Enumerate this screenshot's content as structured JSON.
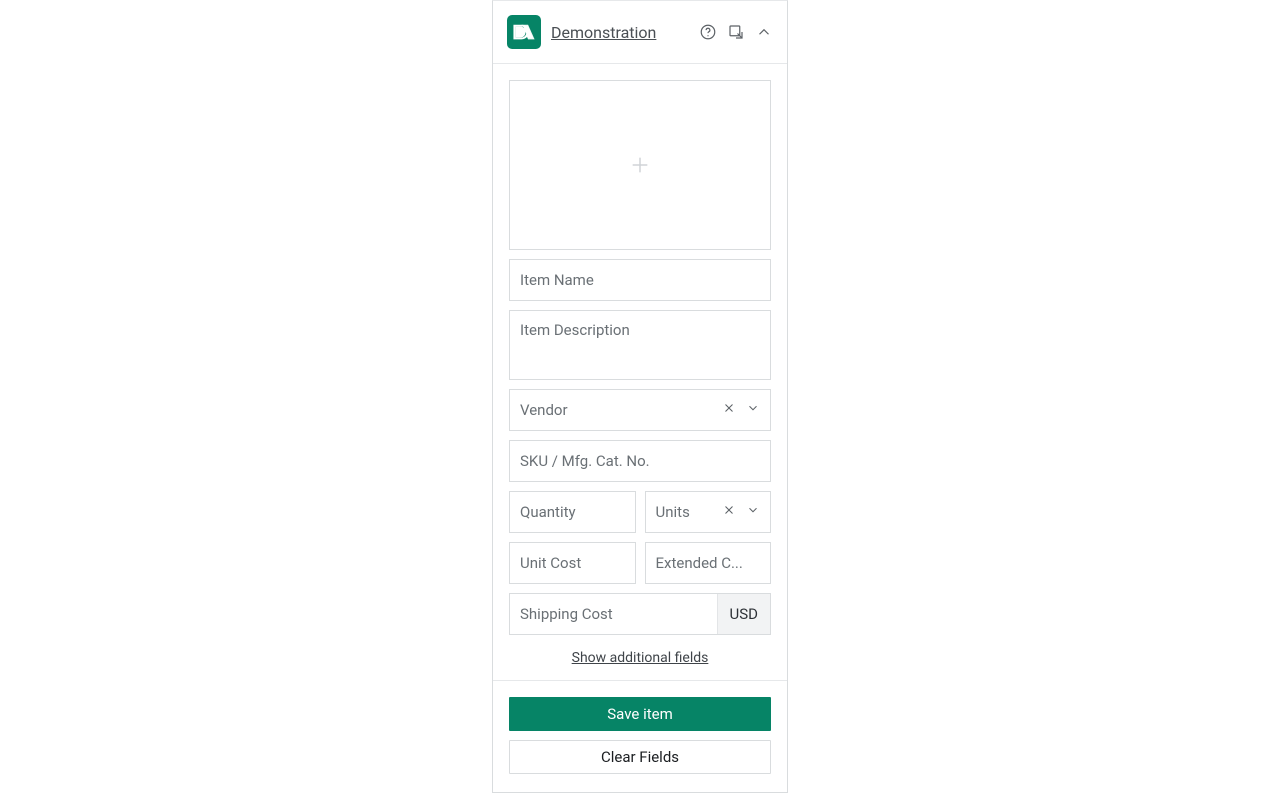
{
  "header": {
    "org_name": "Demonstration",
    "icons": {
      "help": "help-icon",
      "pop_out": "pop-out-icon",
      "collapse": "chevron-up-icon"
    }
  },
  "form": {
    "image_upload": {
      "icon": "plus-icon"
    },
    "item_name": {
      "placeholder": "Item Name"
    },
    "item_description": {
      "placeholder": "Item Description"
    },
    "vendor": {
      "placeholder": "Vendor",
      "clear_icon": "close-icon",
      "dropdown_icon": "chevron-down-icon"
    },
    "sku": {
      "placeholder": "SKU / Mfg. Cat. No."
    },
    "quantity": {
      "placeholder": "Quantity"
    },
    "units": {
      "placeholder": "Units",
      "clear_icon": "close-icon",
      "dropdown_icon": "chevron-down-icon"
    },
    "unit_cost": {
      "placeholder": "Unit Cost"
    },
    "extended_cost": {
      "placeholder": "Extended C..."
    },
    "shipping_cost": {
      "placeholder": "Shipping Cost",
      "currency": "USD"
    },
    "show_more_label": "Show additional fields"
  },
  "footer": {
    "save_label": "Save item",
    "clear_label": "Clear Fields"
  },
  "colors": {
    "brand": "#068466",
    "border": "#d9dcde",
    "text_muted": "#6a7075"
  }
}
